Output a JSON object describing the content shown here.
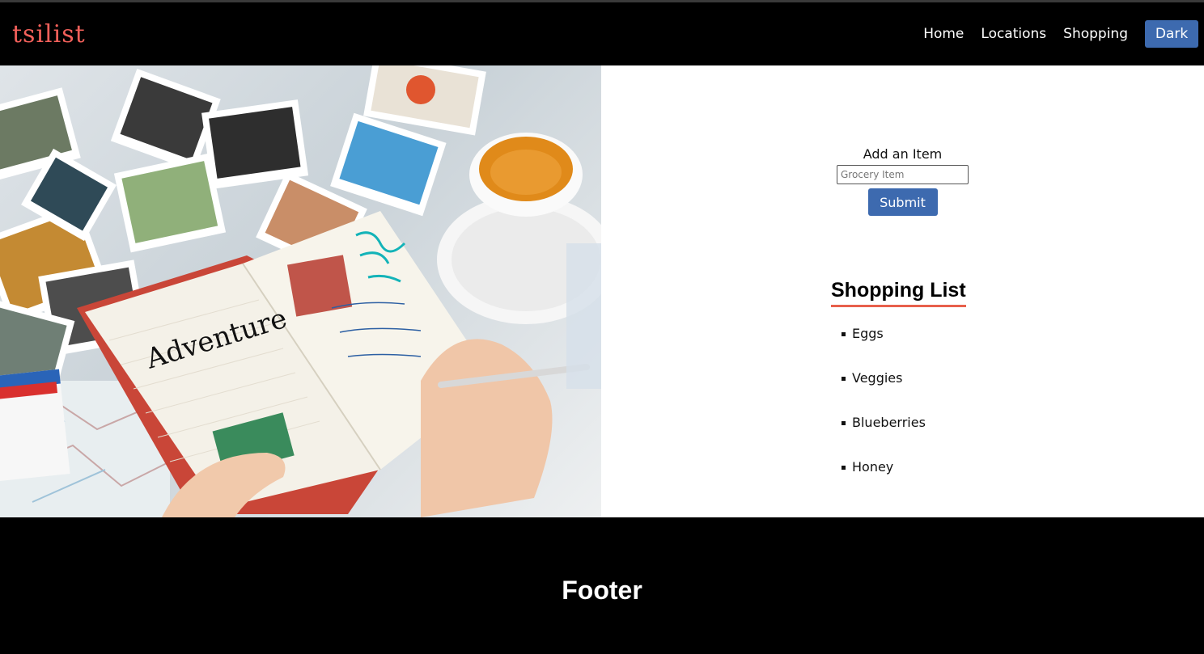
{
  "brand": {
    "logo": "tsilist"
  },
  "nav": {
    "home": "Home",
    "locations": "Locations",
    "shopping": "Shopping",
    "dark": "Dark"
  },
  "form": {
    "label": "Add an Item",
    "placeholder": "Grocery Item",
    "submit": "Submit"
  },
  "list": {
    "title": "Shopping List",
    "items": [
      "Eggs",
      "Veggies",
      "Blueberries",
      "Honey"
    ]
  },
  "footer": {
    "text": "Footer"
  },
  "colors": {
    "accent": "#3d6aaf",
    "brand": "#f2605a",
    "underline": "#e8604c"
  },
  "hero": {
    "handwriting": "Adventure"
  }
}
